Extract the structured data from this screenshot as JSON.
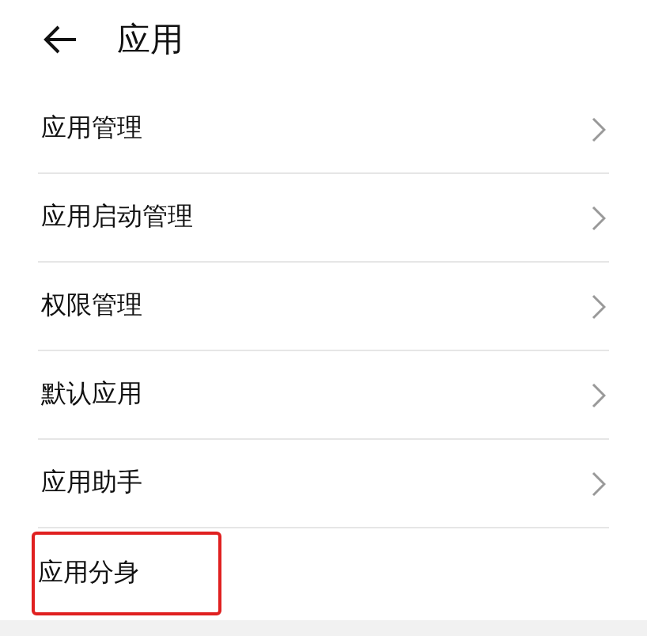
{
  "header": {
    "title": "应用"
  },
  "items": [
    {
      "label": "应用管理",
      "chevron": true,
      "highlighted": false
    },
    {
      "label": "应用启动管理",
      "chevron": true,
      "highlighted": false
    },
    {
      "label": "权限管理",
      "chevron": true,
      "highlighted": false
    },
    {
      "label": "默认应用",
      "chevron": true,
      "highlighted": false
    },
    {
      "label": "应用助手",
      "chevron": true,
      "highlighted": false
    },
    {
      "label": "应用分身",
      "chevron": false,
      "highlighted": true
    }
  ]
}
